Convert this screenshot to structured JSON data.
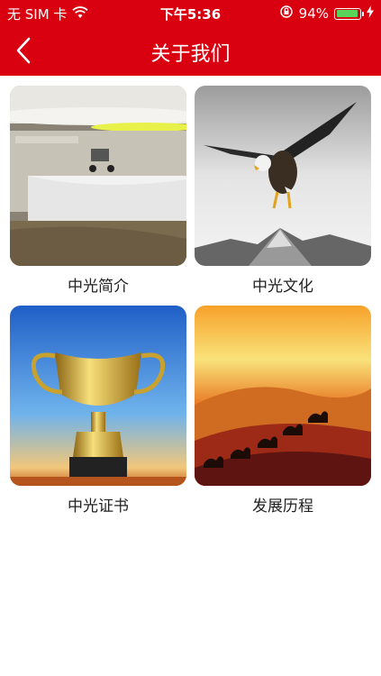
{
  "status_bar": {
    "carrier": "无 SIM 卡",
    "time": "下午5:36",
    "battery_percent": "94%",
    "battery_level": 0.94,
    "icons": [
      "wifi-icon",
      "rotation-lock-icon",
      "battery-icon",
      "charging-bolt-icon"
    ]
  },
  "nav": {
    "title": "关于我们",
    "back_icon": "chevron-left-icon",
    "bar_color": "#d9000f"
  },
  "cards": [
    {
      "label": "中光简介",
      "image": "office-reception-photo"
    },
    {
      "label": "中光文化",
      "image": "eagle-mountain-photo"
    },
    {
      "label": "中光证书",
      "image": "gold-trophy-photo"
    },
    {
      "label": "发展历程",
      "image": "desert-camel-caravan-photo"
    }
  ]
}
